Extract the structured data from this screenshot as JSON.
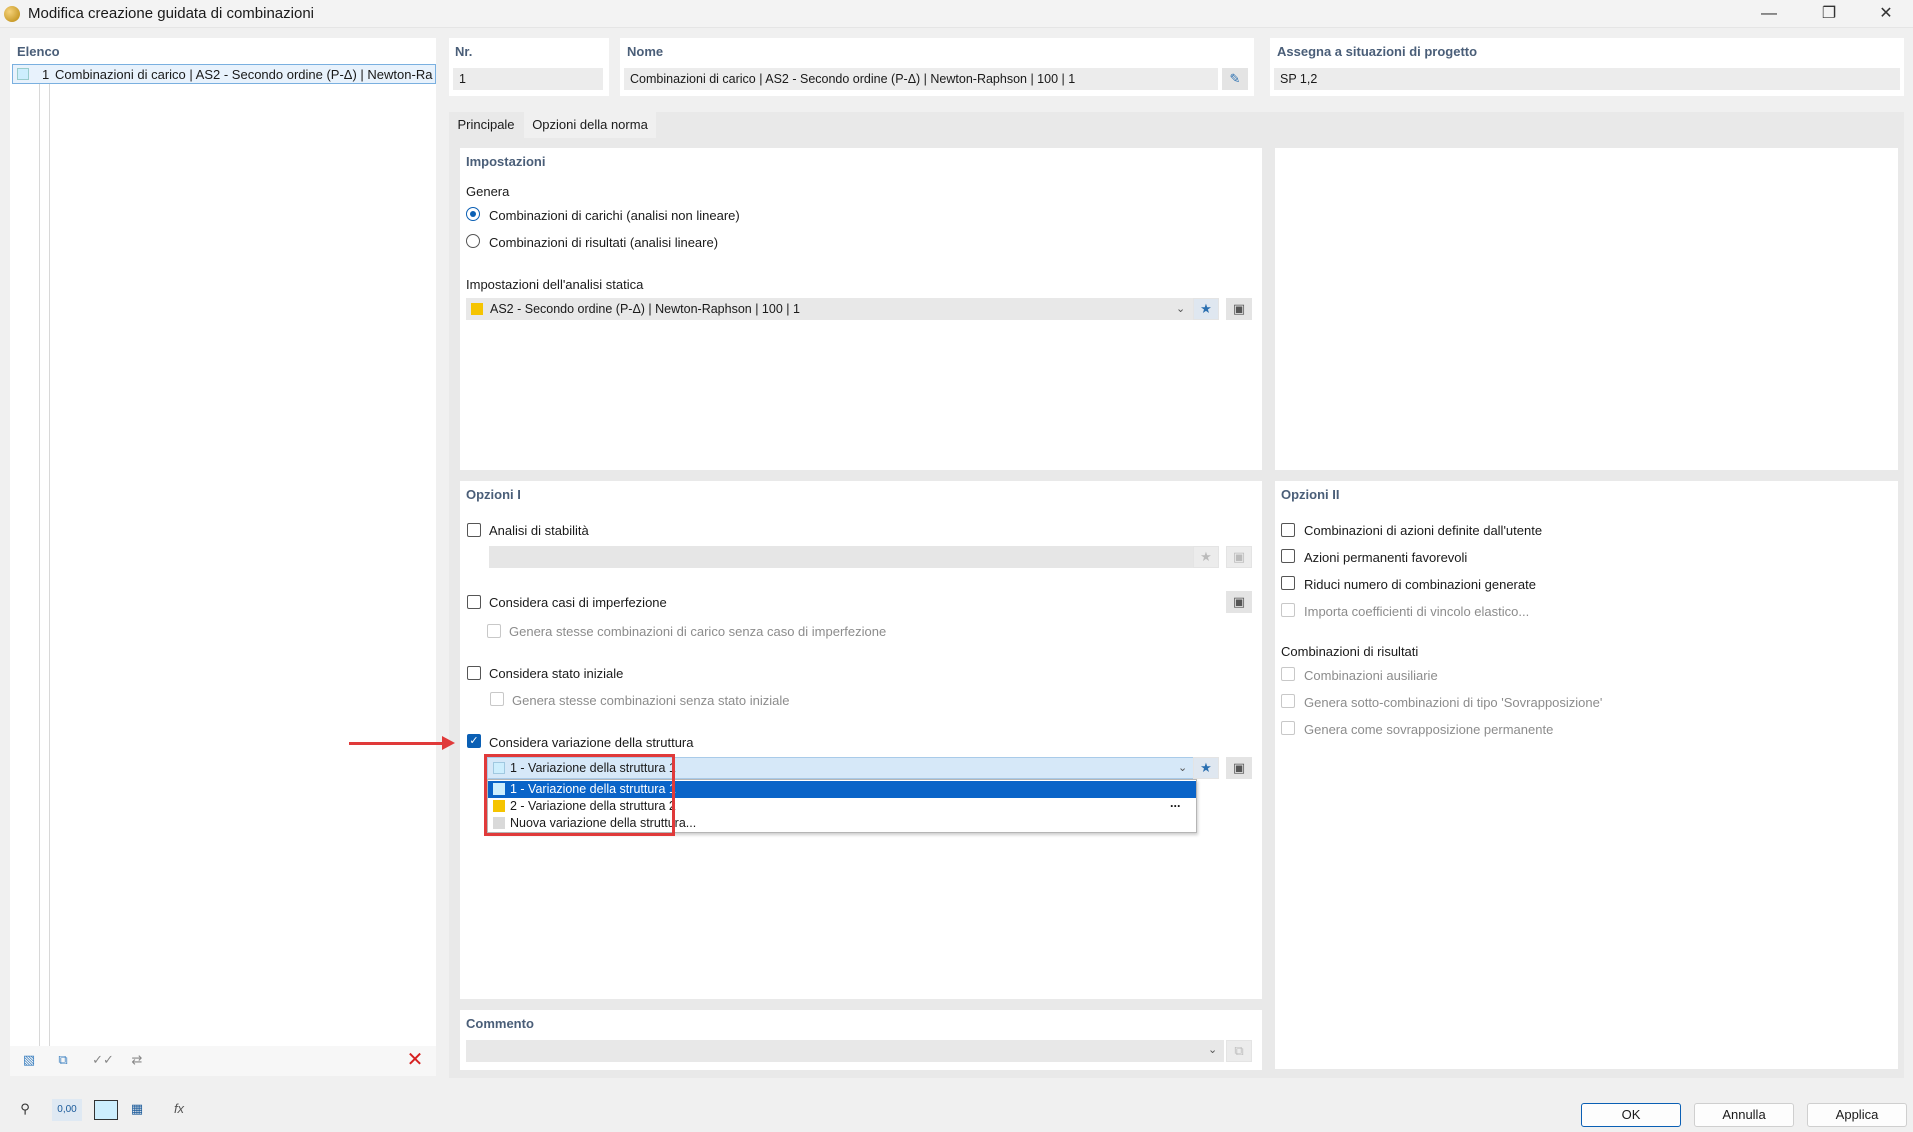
{
  "window": {
    "title": "Modifica creazione guidata di combinazioni"
  },
  "left_panel": {
    "header": "Elenco",
    "items": [
      {
        "number": "1",
        "label": "Combinazioni di carico | AS2 - Secondo ordine (P-Δ) | Newton-Ra"
      }
    ]
  },
  "header_fields": {
    "nr_label": "Nr.",
    "nr_value": "1",
    "name_label": "Nome",
    "name_value": "Combinazioni di carico | AS2 - Secondo ordine (P-Δ) | Newton-Raphson | 100 | 1",
    "assign_label": "Assegna a situazioni di progetto",
    "assign_value": "SP 1,2"
  },
  "tabs": [
    {
      "label": "Principale",
      "active": true
    },
    {
      "label": "Opzioni della norma",
      "active": false
    }
  ],
  "impostazioni": {
    "title": "Impostazioni",
    "genera_label": "Genera",
    "radio_1": "Combinazioni di carichi (analisi non lineare)",
    "radio_2": "Combinazioni di risultati (analisi lineare)",
    "static_label": "Impostazioni dell'analisi statica",
    "static_value": "AS2 - Secondo ordine (P-Δ) | Newton-Raphson | 100 | 1"
  },
  "opzioni1": {
    "title": "Opzioni I",
    "stability": "Analisi di stabilità",
    "imperfection": "Considera casi di imperfezione",
    "imperfection_sub": "Genera stesse combinazioni di carico senza caso di imperfezione",
    "initial_state": "Considera stato iniziale",
    "initial_state_sub": "Genera stesse combinazioni senza stato iniziale",
    "structure_variation": "Considera variazione della struttura",
    "combo_value": "1 - Variazione della struttura 1",
    "dropdown_items": [
      "1 - Variazione della struttura 1",
      "2 - Variazione della struttura 2",
      "Nuova variazione della struttura..."
    ],
    "dropdown_more": "..."
  },
  "opzioni2": {
    "title": "Opzioni II",
    "user_actions": "Combinazioni di azioni definite dall'utente",
    "favorable": "Azioni permanenti favorevoli",
    "reduce": "Riduci numero di combinazioni generate",
    "import_coeff": "Importa coefficienti di vincolo elastico...",
    "result_combos_label": "Combinazioni di risultati",
    "auxiliary": "Combinazioni ausiliarie",
    "sub_combos": "Genera sotto-combinazioni di tipo 'Sovrapposizione'",
    "permanent_overlay": "Genera come sovrapposizione permanente"
  },
  "comment": {
    "label": "Commento",
    "value": ""
  },
  "footer": {
    "value_icon_text": "0,00",
    "ok": "OK",
    "cancel": "Annulla",
    "apply": "Applica"
  },
  "colors": {
    "accent": "#0a5fb4",
    "selection": "#0a64c8",
    "highlight_box": "#e03a3a",
    "swatch_light": "#cdeefd",
    "swatch_yellow": "#f5c400",
    "swatch_gray": "#d9d9d9"
  }
}
